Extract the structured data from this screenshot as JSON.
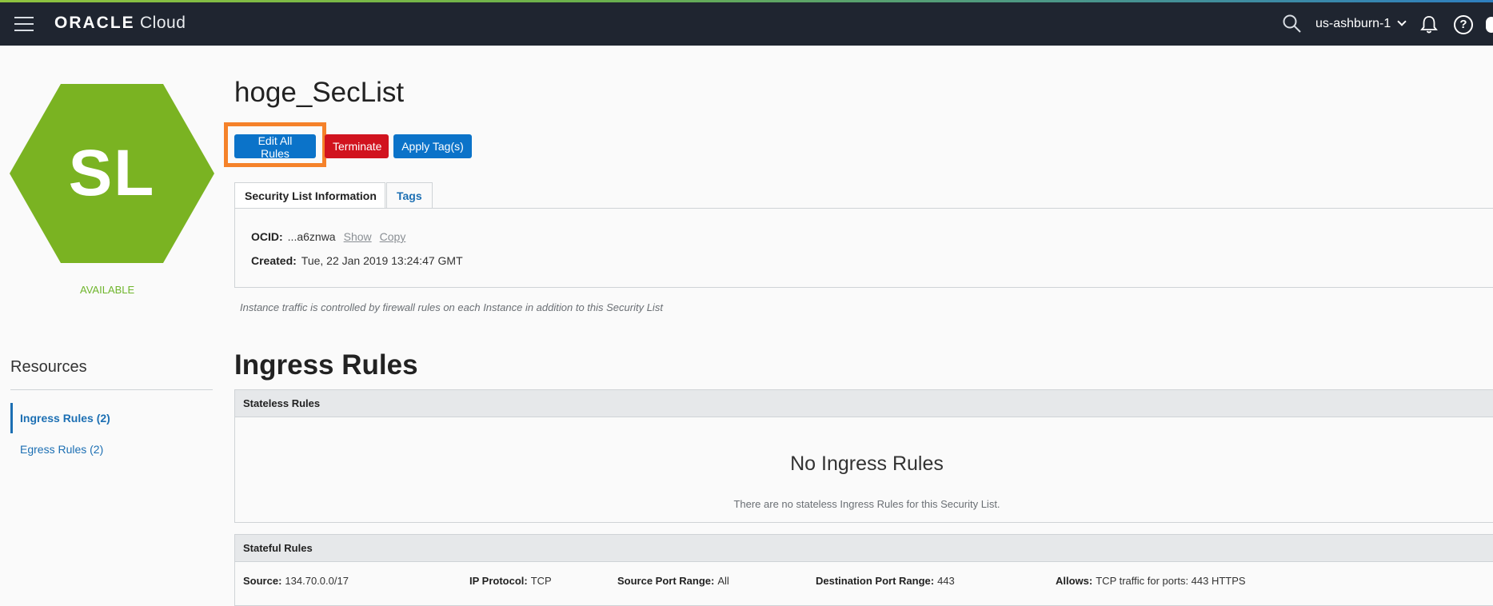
{
  "header": {
    "brand_bold": "ORACLE",
    "brand_light": "Cloud",
    "region": "us-ashburn-1",
    "help_glyph": "?"
  },
  "icons": {
    "menu": "hamburger-menu-icon",
    "search": "search-icon",
    "bell": "bell-icon",
    "help": "help-icon"
  },
  "sidebar": {
    "badge": "SL",
    "badge_color": "#7ab322",
    "status": "AVAILABLE",
    "status_color": "#6fb52c",
    "resources_title": "Resources",
    "items": [
      {
        "label": "Ingress Rules (2)",
        "active": true
      },
      {
        "label": "Egress Rules (2)",
        "active": false
      }
    ]
  },
  "main": {
    "title": "hoge_SecList",
    "buttons": {
      "edit": "Edit All Rules",
      "terminate": "Terminate",
      "apply_tags": "Apply Tag(s)"
    },
    "tabs": [
      {
        "label": "Security List Information",
        "active": true
      },
      {
        "label": "Tags",
        "active": false
      }
    ],
    "info": {
      "ocid_label": "OCID:",
      "ocid_value": "...a6znwa",
      "show_link": "Show",
      "copy_link": "Copy",
      "created_label": "Created:",
      "created_value": "Tue, 22 Jan 2019 13:24:47 GMT"
    },
    "note": "Instance traffic is controlled by firewall rules on each Instance in addition to this Security List",
    "ingress_title": "Ingress Rules",
    "stateless": {
      "header": "Stateless Rules",
      "empty_title": "No Ingress Rules",
      "empty_sub": "There are no stateless Ingress Rules for this Security List."
    },
    "stateful": {
      "header": "Stateful Rules",
      "rows": [
        {
          "source_label": "Source:",
          "source": "134.70.0.0/17",
          "protocol_label": "IP Protocol:",
          "protocol": "TCP",
          "src_port_label": "Source Port Range:",
          "src_port": "All",
          "dst_port_label": "Destination Port Range:",
          "dst_port": "443",
          "allows_label": "Allows:",
          "allows": "TCP traffic for ports: 443 HTTPS"
        }
      ]
    }
  },
  "colors": {
    "topbar": "#1f2530",
    "primary_button": "#0b73c9",
    "danger_button": "#d1131e",
    "highlight": "#f5822a",
    "link": "#1c6fb3"
  }
}
